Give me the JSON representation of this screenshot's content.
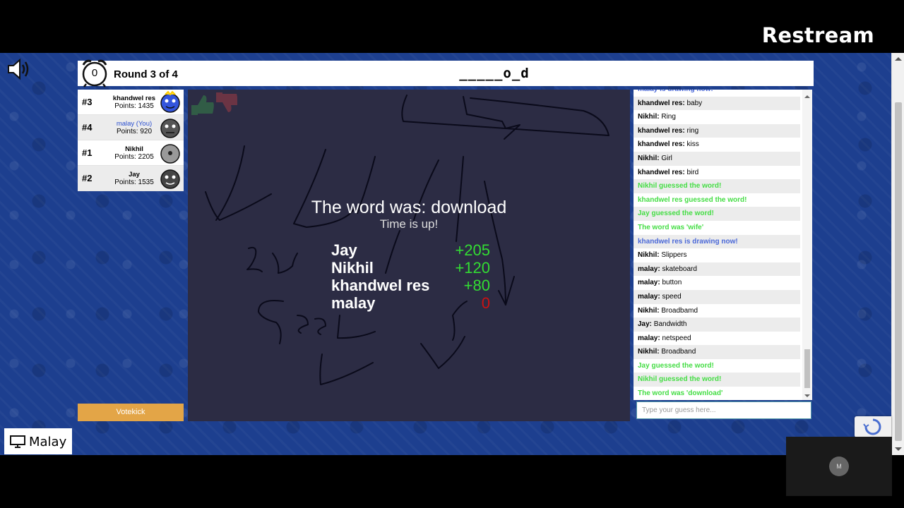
{
  "stream": {
    "brand": "Restream"
  },
  "header": {
    "timer": "0",
    "round": "Round 3 of 4",
    "word_hint": "_____o_d"
  },
  "players": [
    {
      "rank": "#3",
      "name": "khandwel res",
      "points": "Points: 1435",
      "is_you": false,
      "avatar_color": "#3355dd"
    },
    {
      "rank": "#4",
      "name": "malay (You)",
      "points": "Points: 920",
      "is_you": true,
      "avatar_color": "#555555"
    },
    {
      "rank": "#1",
      "name": "Nikhil",
      "points": "Points: 2205",
      "is_you": false,
      "avatar_color": "#888888"
    },
    {
      "rank": "#2",
      "name": "Jay",
      "points": "Points: 1535",
      "is_you": false,
      "avatar_color": "#444444"
    }
  ],
  "votekick": {
    "label": "Votekick"
  },
  "overlay": {
    "reveal": "The word was: download",
    "time_up": "Time is up!",
    "scores": [
      {
        "name": "Jay",
        "score": "+205"
      },
      {
        "name": "Nikhil",
        "score": "+120"
      },
      {
        "name": "khandwel res",
        "score": "+80"
      },
      {
        "name": "malay",
        "score": "0"
      }
    ]
  },
  "chat": {
    "messages": [
      {
        "type": "blue",
        "text": "malay is drawing now!"
      },
      {
        "type": "msg",
        "who": "khandwel res:",
        "text": "baby"
      },
      {
        "type": "msg",
        "who": "Nikhil:",
        "text": "Ring"
      },
      {
        "type": "msg",
        "who": "khandwel res:",
        "text": "ring"
      },
      {
        "type": "msg",
        "who": "khandwel res:",
        "text": "kiss"
      },
      {
        "type": "msg",
        "who": "Nikhil:",
        "text": "Girl"
      },
      {
        "type": "msg",
        "who": "khandwel res:",
        "text": "bird"
      },
      {
        "type": "green",
        "text": "Nikhil guessed the word!"
      },
      {
        "type": "green",
        "text": "khandwel res guessed the word!"
      },
      {
        "type": "green",
        "text": "Jay guessed the word!"
      },
      {
        "type": "green",
        "text": "The word was 'wife'"
      },
      {
        "type": "blue",
        "text": "khandwel res is drawing now!"
      },
      {
        "type": "msg",
        "who": "Nikhil:",
        "text": "Slippers"
      },
      {
        "type": "msg",
        "who": "malay:",
        "text": "skateboard"
      },
      {
        "type": "msg",
        "who": "malay:",
        "text": "button"
      },
      {
        "type": "msg",
        "who": "malay:",
        "text": "speed"
      },
      {
        "type": "msg",
        "who": "Nikhil:",
        "text": "Broadbamd"
      },
      {
        "type": "msg",
        "who": "Jay:",
        "text": "Bandwidth"
      },
      {
        "type": "msg",
        "who": "malay:",
        "text": "netspeed"
      },
      {
        "type": "msg",
        "who": "Nikhil:",
        "text": "Broadband"
      },
      {
        "type": "green",
        "text": "Jay guessed the word!"
      },
      {
        "type": "green",
        "text": "Nikhil guessed the word!"
      },
      {
        "type": "green",
        "text": "The word was 'download'"
      }
    ],
    "input_placeholder": "Type your guess here..."
  },
  "viewer": {
    "name": "Malay",
    "avatar_initial": "M"
  }
}
